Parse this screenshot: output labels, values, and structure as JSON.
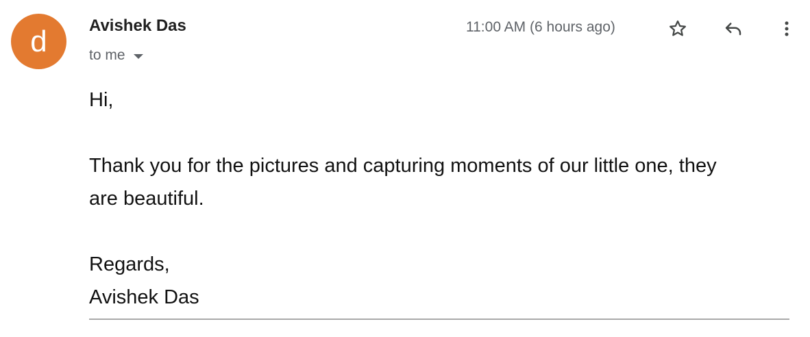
{
  "sender": {
    "avatar_letter": "d",
    "avatar_color": "#e37a30",
    "name": "Avishek Das"
  },
  "recipient": {
    "label": "to me",
    "dropdown_icon": "caret-down-icon"
  },
  "meta": {
    "timestamp": "11:00 AM (6 hours ago)"
  },
  "actions": {
    "star_icon": "star-icon",
    "reply_icon": "reply-icon",
    "more_icon": "more-vertical-icon"
  },
  "message": {
    "greeting": "Hi,",
    "body_line_1": "Thank you for the pictures and capturing moments of our little one, they",
    "body_line_2": "are beautiful.",
    "signoff": "Regards,",
    "signature": "Avishek Das"
  }
}
